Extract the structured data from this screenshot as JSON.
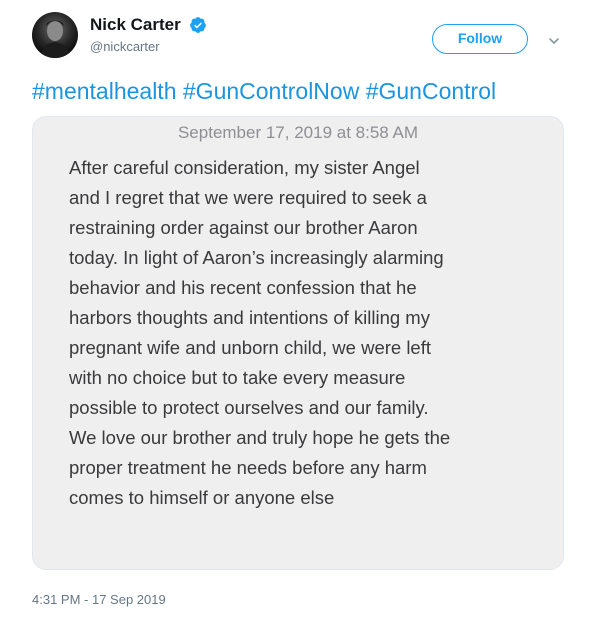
{
  "tweet": {
    "author": {
      "name": "Nick Carter",
      "handle": "@nickcarter",
      "verified": true,
      "avatar_icon": "profile-photo"
    },
    "follow_label": "Follow",
    "menu_icon": "chevron-down-icon",
    "hashtags": [
      "#mentalhealth",
      "#GunControlNow",
      "#GunControl"
    ],
    "image_note": {
      "date": "September 17, 2019 at 8:58 AM",
      "lines": [
        "After careful consideration, my sister Angel",
        "and I regret that we were required to seek a",
        "restraining order against our brother Aaron",
        "today.  In light of Aaron’s increasingly alarming",
        "behavior and his recent confession that he",
        "harbors thoughts and intentions of killing my",
        "pregnant wife and unborn child, we were left",
        "with no choice but to take every measure",
        "possible to protect ourselves and our family.",
        "We love our brother and truly hope he gets the",
        "proper treatment he needs before any harm",
        "comes to himself or anyone else"
      ]
    },
    "timestamp": "4:31 PM - 17 Sep 2019"
  },
  "colors": {
    "accent": "#1da1f2",
    "hashtag": "#1b95e0",
    "muted": "#657786",
    "note_background": "#efeff0"
  }
}
